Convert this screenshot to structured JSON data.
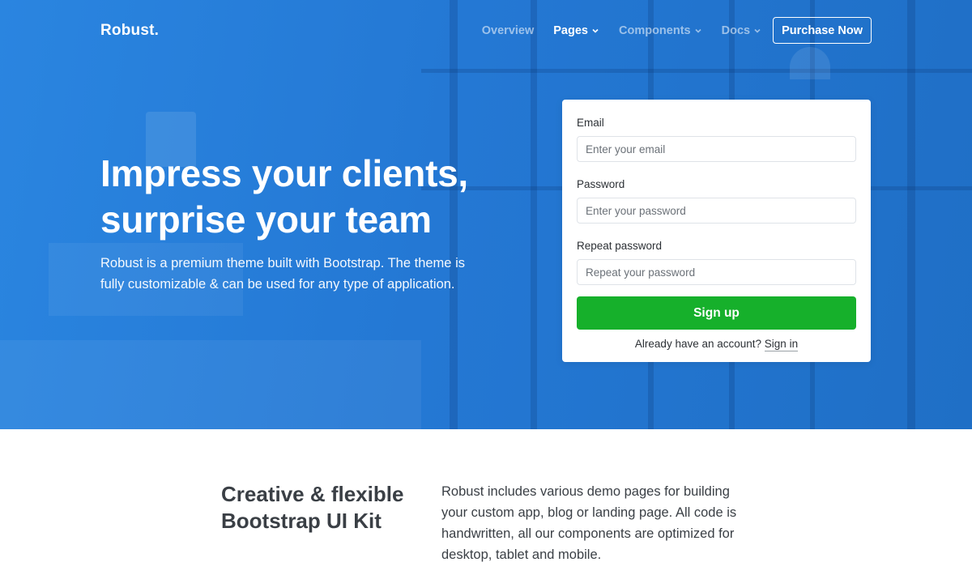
{
  "brand": "Robust.",
  "nav": {
    "items": [
      {
        "label": "Overview",
        "dropdown": false,
        "active": false
      },
      {
        "label": "Pages",
        "dropdown": true,
        "active": true
      },
      {
        "label": "Components",
        "dropdown": true,
        "active": false
      },
      {
        "label": "Docs",
        "dropdown": true,
        "active": false
      }
    ],
    "purchase_label": "Purchase Now"
  },
  "hero": {
    "title_line1": "Impress your clients,",
    "title_line2": "surprise your team",
    "subtitle": "Robust is a premium theme built with Bootstrap. The theme is fully customizable & can be used for any type of application."
  },
  "signup": {
    "email_label": "Email",
    "email_placeholder": "Enter your email",
    "email_value": "",
    "password_label": "Password",
    "password_placeholder": "Enter your password",
    "password_value": "",
    "repeat_label": "Repeat password",
    "repeat_placeholder": "Repeat your password",
    "repeat_value": "",
    "button_label": "Sign up",
    "account_prompt": "Already have an account?",
    "signin_label": "Sign in"
  },
  "features": {
    "title": "Creative & flexible Bootstrap UI Kit",
    "text": "Robust includes various demo pages for building your custom app, blog or landing page. All code is handwritten, all our components are optimized for desktop, tablet and mobile."
  },
  "colors": {
    "hero_blue": "#2478d4",
    "signup_green": "#16b02b",
    "text_dark": "#3a3f45"
  },
  "icons": {
    "dropdown": "chevron-down-icon"
  }
}
